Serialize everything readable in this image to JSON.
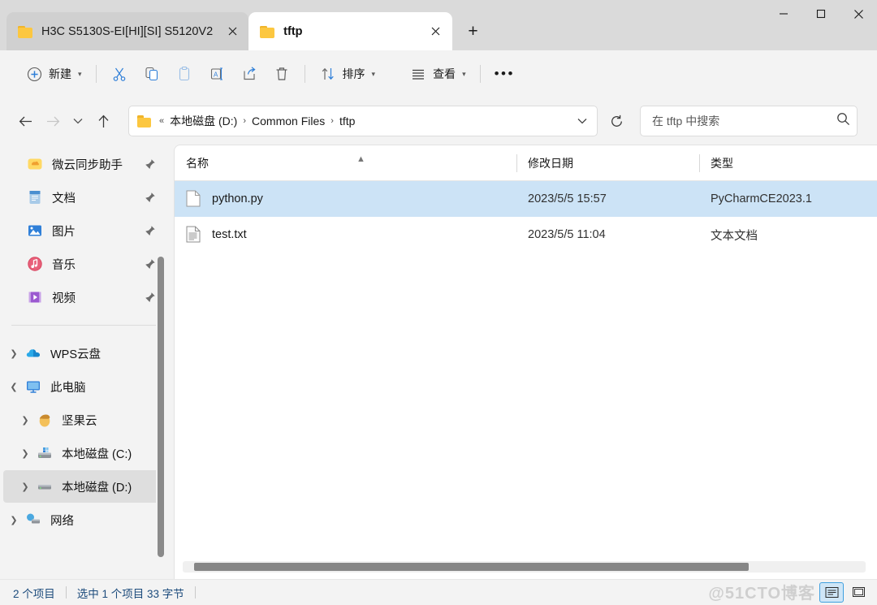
{
  "window": {
    "tabs": [
      {
        "label": "H3C S5130S-EI[HI][SI] S5120V2",
        "icon": "folder-icon",
        "active": false
      },
      {
        "label": "tftp",
        "icon": "folder-icon",
        "active": true
      }
    ],
    "new_tab_label": "+",
    "controls": {
      "minimize": "minimize-icon",
      "maximize": "maximize-icon",
      "close": "close-icon"
    }
  },
  "toolbar": {
    "new_label": "新建",
    "cut_label": "剪切",
    "copy_label": "复制",
    "paste_label": "粘贴",
    "rename_label": "重命名",
    "share_label": "共享",
    "delete_label": "删除",
    "sort_label": "排序",
    "view_label": "查看",
    "more_label": "查看更多"
  },
  "navbar": {
    "back_label": "返回",
    "forward_label": "前进",
    "recent_label": "最近位置",
    "up_label": "向上",
    "breadcrumbs": [
      "本地磁盘 (D:)",
      "Common Files",
      "tftp"
    ],
    "breadcrumb_prefix": "«",
    "separator": "›",
    "refresh_label": "刷新",
    "search_placeholder": "在 tftp 中搜索",
    "search_value": ""
  },
  "sidebar": {
    "quick_access": [
      {
        "label": "微云同步助手",
        "icon": "cloud-sync-icon",
        "pinned": true
      },
      {
        "label": "文档",
        "icon": "documents-icon",
        "pinned": true
      },
      {
        "label": "图片",
        "icon": "pictures-icon",
        "pinned": true
      },
      {
        "label": "音乐",
        "icon": "music-icon",
        "pinned": true
      },
      {
        "label": "视频",
        "icon": "videos-icon",
        "pinned": true
      }
    ],
    "tree": [
      {
        "label": "WPS云盘",
        "icon": "wps-cloud-icon",
        "expanded": false,
        "level": 0,
        "selected": false
      },
      {
        "label": "此电脑",
        "icon": "this-pc-icon",
        "expanded": true,
        "level": 0,
        "selected": false
      },
      {
        "label": "坚果云",
        "icon": "nutstore-icon",
        "expanded": false,
        "level": 1,
        "selected": false
      },
      {
        "label": "本地磁盘 (C:)",
        "icon": "drive-system-icon",
        "expanded": false,
        "level": 1,
        "selected": false
      },
      {
        "label": "本地磁盘 (D:)",
        "icon": "drive-icon",
        "expanded": false,
        "level": 1,
        "selected": true
      },
      {
        "label": "网络",
        "icon": "network-icon",
        "expanded": false,
        "level": 0,
        "selected": false
      }
    ]
  },
  "filelist": {
    "columns": [
      "名称",
      "修改日期",
      "类型"
    ],
    "sort_column": "名称",
    "sort_direction": "ascending",
    "rows": [
      {
        "name": "python.py",
        "date": "2023/5/5 15:57",
        "type": "PyCharmCE2023.1",
        "icon": "blank-file-icon",
        "selected": true
      },
      {
        "name": "test.txt",
        "date": "2023/5/5 11:04",
        "type": "文本文档",
        "icon": "text-file-icon",
        "selected": false
      }
    ]
  },
  "statusbar": {
    "item_count": "2 个项目",
    "selection": "选中 1 个项目  33 字节",
    "details_view_label": "详细信息",
    "tiles_view_label": "大图标",
    "active_view": "details",
    "watermark": "@51CTO博客"
  }
}
